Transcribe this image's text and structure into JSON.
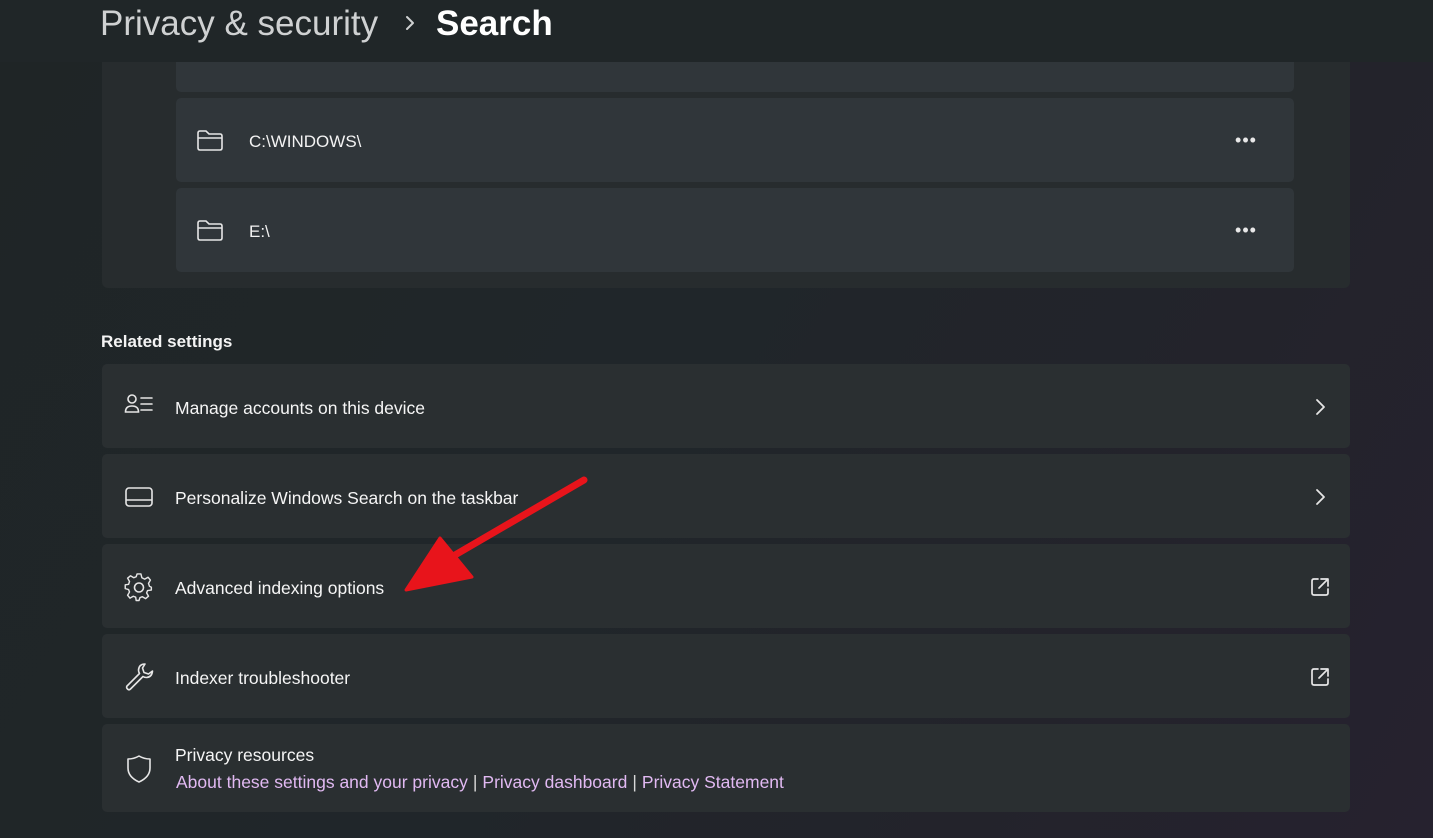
{
  "breadcrumb": {
    "parent": "Privacy & security",
    "current": "Search"
  },
  "folders": [
    {
      "path": "C:\\WINDOWS\\",
      "icon": "folder-icon",
      "action_icon": "more-options-icon"
    },
    {
      "path": "E:\\",
      "icon": "folder-icon",
      "action_icon": "more-options-icon"
    }
  ],
  "related_settings": {
    "title": "Related settings",
    "items": [
      {
        "label": "Manage accounts on this device",
        "icon": "accounts-icon",
        "action": "chevron-right-icon"
      },
      {
        "label": "Personalize Windows Search on the taskbar",
        "icon": "taskbar-icon",
        "action": "chevron-right-icon"
      },
      {
        "label": "Advanced indexing options",
        "icon": "gear-icon",
        "action": "external-link-icon"
      },
      {
        "label": "Indexer troubleshooter",
        "icon": "wrench-icon",
        "action": "external-link-icon"
      }
    ]
  },
  "privacy_resources": {
    "title": "Privacy resources",
    "icon": "shield-icon",
    "links": [
      "About these settings and your privacy",
      "Privacy dashboard",
      "Privacy Statement"
    ],
    "separator": "|"
  },
  "colors": {
    "link": "#e1b9f2",
    "annotation_arrow": "#e8141b",
    "card_background": "#2a2f31"
  }
}
